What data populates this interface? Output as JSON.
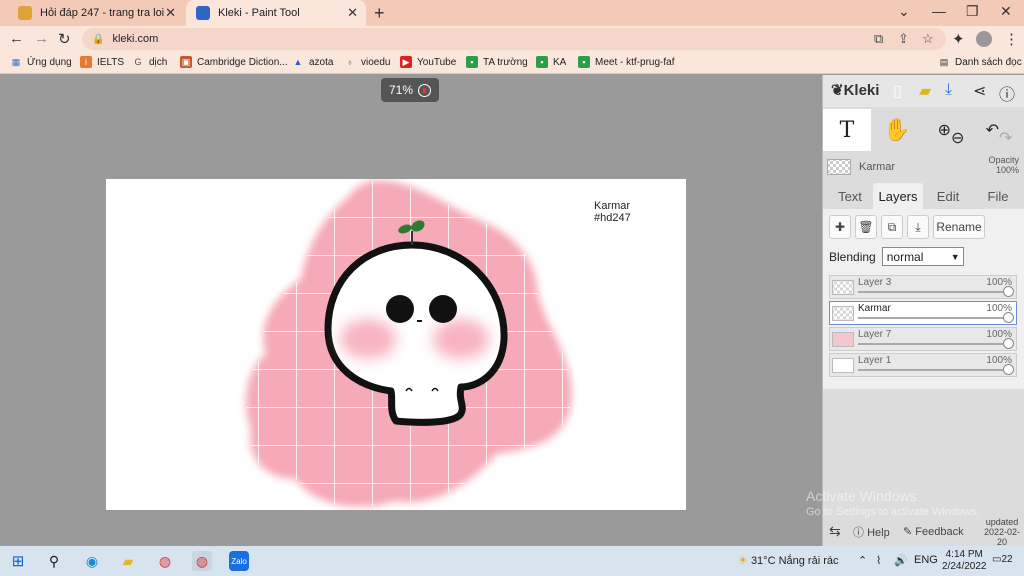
{
  "browser": {
    "tabs": [
      {
        "label": "Hỏi đáp 247 - trang tra loi",
        "active": false,
        "favicon_color": "#e0a03a"
      },
      {
        "label": "Kleki - Paint Tool",
        "active": true,
        "favicon_color": "#2f66c9"
      }
    ],
    "url": "kleki.com",
    "bookmarks": [
      {
        "label": "Ứng dụng",
        "icon": "apps-grid-icon"
      },
      {
        "label": "IELTS",
        "icon": "ielts-icon"
      },
      {
        "label": "dịch",
        "icon": "google-icon"
      },
      {
        "label": "Cambridge Diction...",
        "icon": "cambridge-icon"
      },
      {
        "label": "azota",
        "icon": "azota-icon"
      },
      {
        "label": "vioedu",
        "icon": "vioedu-icon"
      },
      {
        "label": "YouTube",
        "icon": "youtube-icon"
      },
      {
        "label": "TA trường",
        "icon": "classroom-icon"
      },
      {
        "label": "KA",
        "icon": "classroom-icon"
      },
      {
        "label": "Meet - ktf-prug-faf",
        "icon": "classroom-icon"
      }
    ],
    "reading_list": "Danh sách đọc"
  },
  "canvas": {
    "zoom": "71%",
    "text_line1": "Karmar",
    "text_line2": "#hd247",
    "pink": "#f6a9b6"
  },
  "kleki": {
    "logo": "Kleki",
    "current_layer": "Karmar",
    "opacity_label": "Opacity",
    "opacity_value": "100%",
    "tabs": [
      "Text",
      "Layers",
      "Edit",
      "File"
    ],
    "active_tab": "Layers",
    "rename_label": "Rename",
    "blending_label": "Blending",
    "blending_value": "normal",
    "layers": [
      {
        "name": "Layer 3",
        "opacity": "100%",
        "selected": false
      },
      {
        "name": "Karmar",
        "opacity": "100%",
        "selected": true
      },
      {
        "name": "Layer 7",
        "opacity": "100%",
        "selected": false
      },
      {
        "name": "Layer 1",
        "opacity": "100%",
        "selected": false
      }
    ],
    "help_label": "Help",
    "feedback_label": "Feedback",
    "updated_label": "updated",
    "updated_date": "2022-02-20"
  },
  "watermark": {
    "line1": "Activate Windows",
    "line2": "Go to Settings to activate Windows."
  },
  "taskbar": {
    "weather": "31°C  Nắng rải rác",
    "lang": "ENG",
    "time": "4:14 PM",
    "date": "2/24/2022",
    "notifications": "22"
  }
}
